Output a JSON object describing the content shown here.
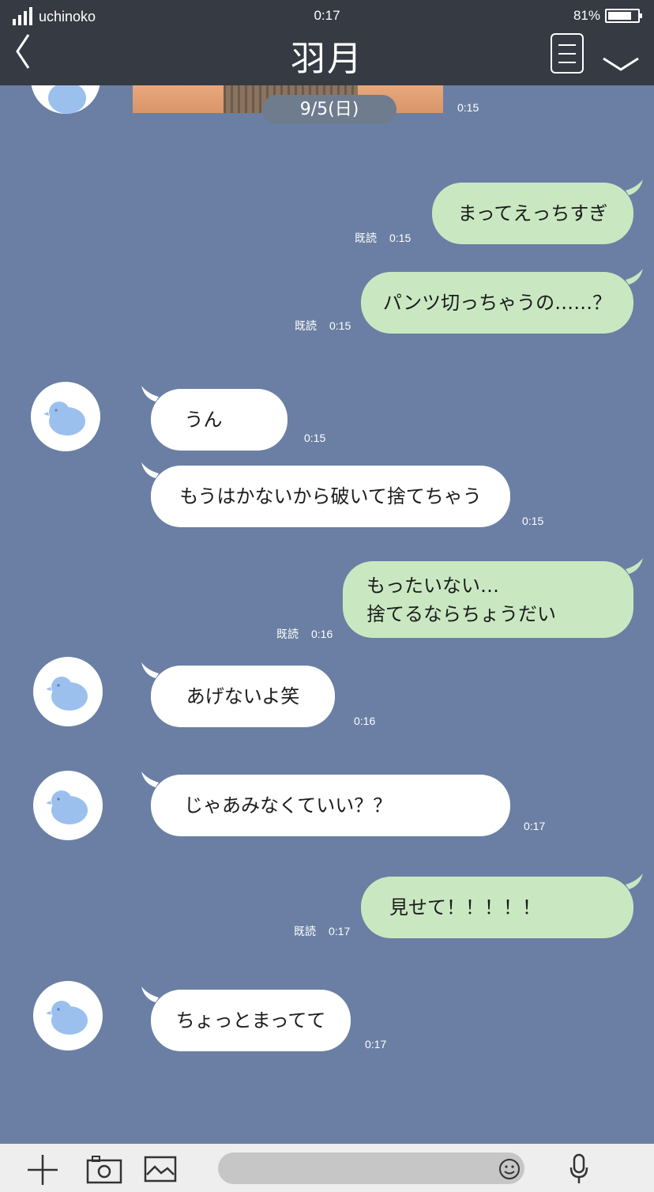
{
  "status_bar": {
    "carrier": "uchinoko",
    "time": "0:17",
    "battery_percent": "81%",
    "battery_level": 0.81
  },
  "header": {
    "title": "羽月"
  },
  "date_separator": "9/5(日)",
  "top_image_time": "0:15",
  "messages": [
    {
      "direction": "out",
      "text": "まってえっちすぎ",
      "read": "既読",
      "time": "0:15"
    },
    {
      "direction": "out",
      "text": "パンツ切っちゃうの……？",
      "read": "既読",
      "time": "0:15"
    },
    {
      "direction": "in",
      "text": "うん",
      "time": "0:15"
    },
    {
      "direction": "in",
      "text": "もうはかないから破いて捨てちゃう",
      "time": "0:15"
    },
    {
      "direction": "out",
      "text": "もったいない…\n捨てるならちょうだい",
      "read": "既読",
      "time": "0:16"
    },
    {
      "direction": "in",
      "text": "あげないよ笑",
      "time": "0:16"
    },
    {
      "direction": "in",
      "text": "じゃあみなくていい？？",
      "time": "0:17"
    },
    {
      "direction": "out",
      "text": "見せて！！！！！",
      "read": "既読",
      "time": "0:17"
    },
    {
      "direction": "in",
      "text": "ちょっとまってて",
      "time": "0:17"
    }
  ],
  "input": {
    "value": "",
    "placeholder": ""
  },
  "colors": {
    "background": "#6a7fa3",
    "header": "#353a43",
    "incoming_bubble": "#ffffff",
    "outgoing_bubble": "#c9e8c2",
    "avatar_bird": "#9cc0ee"
  },
  "icons": {
    "back": "chevron-left-icon",
    "menu": "menu-icon",
    "collapse": "chevron-down-icon",
    "add": "plus-icon",
    "camera": "camera-icon",
    "gallery": "image-icon",
    "emoji": "smiley-icon",
    "voice": "microphone-icon"
  }
}
